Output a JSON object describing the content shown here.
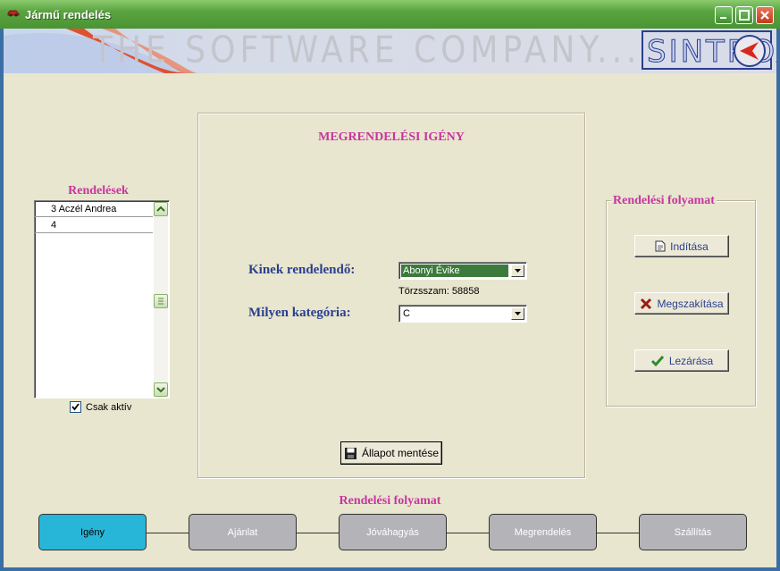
{
  "window": {
    "title": "Jármű rendelés"
  },
  "banner": {
    "tagline": "THE SOFTWARE COMPANY...",
    "logo": "SINTROX"
  },
  "orders": {
    "heading": "Rendelések",
    "items": [
      "3 Aczél Andrea",
      "4"
    ],
    "active_only_label": "Csak aktív",
    "active_only_checked": true
  },
  "request": {
    "heading": "MEGRENDELÉSI IGÉNY",
    "recipient_label": "Kinek rendelendő:",
    "recipient_value": "Abonyi Évike",
    "employee_id": "Törzsszam: 58858",
    "category_label": "Milyen kategória:",
    "category_value": "C",
    "save_button": "Állapot mentése"
  },
  "process_box": {
    "heading": "Rendelési folyamat",
    "start_button": "Indítása",
    "abort_button": "Megszakítása",
    "close_button": "Lezárása"
  },
  "process_steps": {
    "heading": "Rendelési folyamat",
    "steps": [
      "Igény",
      "Ajánlat",
      "Jóváhagyás",
      "Megrendelés",
      "Szállítás"
    ],
    "active_index": 0
  },
  "colors": {
    "accent_pink": "#c8359e",
    "label_blue": "#2a3f8f",
    "active_step": "#27b6d8",
    "inactive_step": "#b4b4b8"
  },
  "icons": {
    "title": "car-icon",
    "save": "floppy-disk-icon",
    "start": "document-icon",
    "abort": "red-x-icon",
    "close": "green-check-icon"
  }
}
